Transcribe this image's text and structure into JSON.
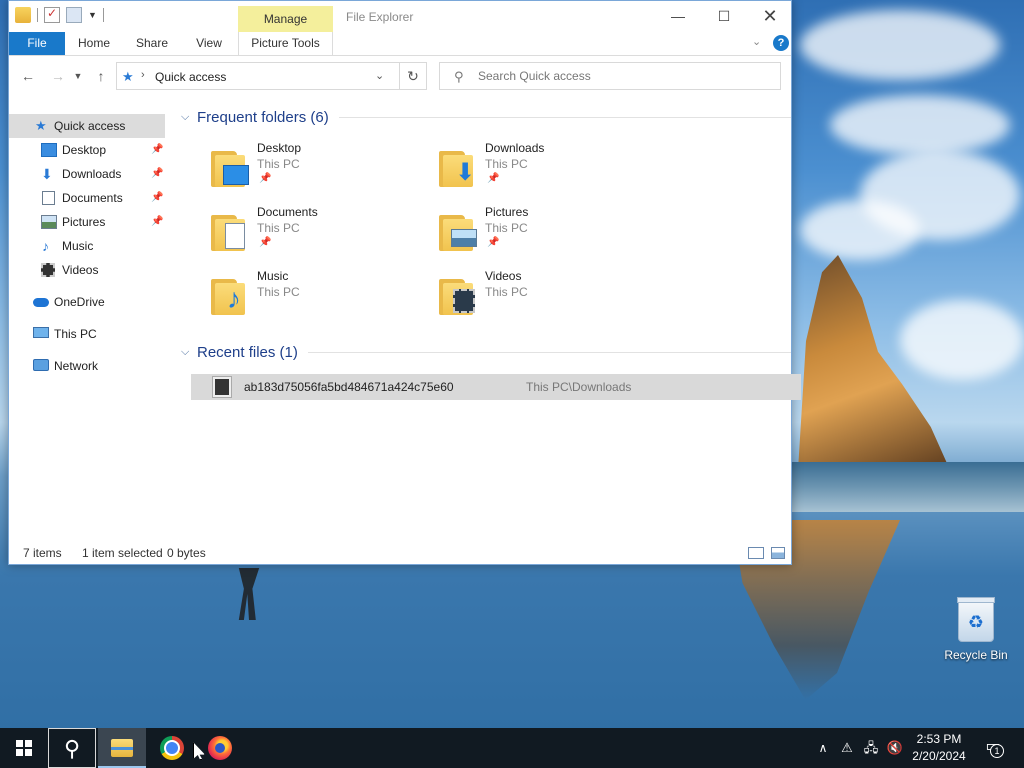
{
  "window": {
    "title": "File Explorer",
    "contextual_tab": "Manage",
    "minimize": "—",
    "maximize": "☐",
    "close": "✕"
  },
  "ribbon": {
    "tabs": [
      "File",
      "Home",
      "Share",
      "View",
      "Picture Tools"
    ],
    "help": "?"
  },
  "nav": {
    "address": "Quick access",
    "search_placeholder": "Search Quick access"
  },
  "sidebar": {
    "items": [
      {
        "label": "Quick access",
        "icon": "star-icon"
      },
      {
        "label": "Desktop",
        "icon": "desktop-icon",
        "pinned": true
      },
      {
        "label": "Downloads",
        "icon": "download-icon",
        "pinned": true
      },
      {
        "label": "Documents",
        "icon": "document-icon",
        "pinned": true
      },
      {
        "label": "Pictures",
        "icon": "pictures-icon",
        "pinned": true
      },
      {
        "label": "Music",
        "icon": "music-icon"
      },
      {
        "label": "Videos",
        "icon": "videos-icon"
      },
      {
        "label": "OneDrive",
        "icon": "cloud-icon"
      },
      {
        "label": "This PC",
        "icon": "computer-icon"
      },
      {
        "label": "Network",
        "icon": "network-icon"
      }
    ]
  },
  "frequent": {
    "title": "Frequent folders (6)",
    "folders": [
      {
        "name": "Desktop",
        "location": "This PC",
        "pinned": true
      },
      {
        "name": "Downloads",
        "location": "This PC",
        "pinned": true
      },
      {
        "name": "Documents",
        "location": "This PC",
        "pinned": true
      },
      {
        "name": "Pictures",
        "location": "This PC",
        "pinned": true
      },
      {
        "name": "Music",
        "location": "This PC",
        "pinned": false
      },
      {
        "name": "Videos",
        "location": "This PC",
        "pinned": false
      }
    ]
  },
  "recent": {
    "title": "Recent files (1)",
    "files": [
      {
        "name": "ab183d75056fa5bd484671a424c75e60",
        "path": "This PC\\Downloads"
      }
    ]
  },
  "status": {
    "items": "7 items",
    "selected": "1 item selected",
    "size": "0 bytes"
  },
  "desktop": {
    "recycle_bin": "Recycle Bin"
  },
  "taskbar": {
    "time": "2:53 PM",
    "date": "2/20/2024",
    "notifications": "1"
  },
  "colors": {
    "accent": "#1979ca",
    "manage_tab": "#f4ef9c",
    "selection": "#d9d9d9"
  }
}
